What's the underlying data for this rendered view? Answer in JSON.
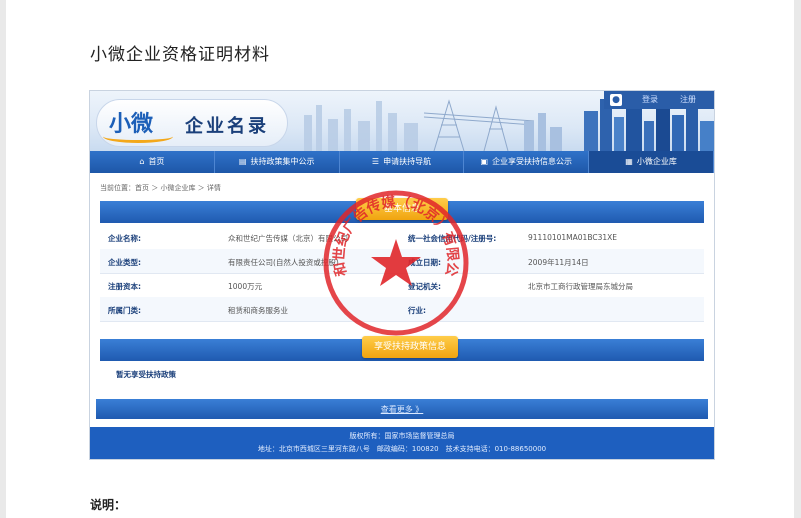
{
  "document": {
    "title": "小微企业资格证明材料",
    "note_label": "说明："
  },
  "site": {
    "logo_mark": "小微",
    "logo_text": "企业名录",
    "user_links": [
      "登录",
      "注册"
    ],
    "nav": [
      "首页",
      "扶持政策集中公示",
      "申请扶持导航",
      "企业享受扶持信息公示",
      "小微企业库"
    ],
    "active_nav": 4,
    "breadcrumb": "当前位置：首页 ＞ 小微企业库 ＞ 详情",
    "section_basic": "基本信息",
    "section_policy": "享受扶持政策信息",
    "rows": [
      {
        "l1": "企业名称:",
        "v1": "众和世纪广告传媒（北京）有限公司",
        "l2": "统一社会信用代码/注册号:",
        "v2": "91110101MA01BC31XE"
      },
      {
        "l1": "企业类型:",
        "v1": "有限责任公司(自然人投资或控股)",
        "l2": "成立日期:",
        "v2": "2009年11月14日"
      },
      {
        "l1": "注册资本:",
        "v1": "1000万元",
        "l2": "登记机关:",
        "v2": "北京市工商行政管理局东城分局"
      },
      {
        "l1": "所属门类:",
        "v1": "租赁和商务服务业",
        "l2": "行业:",
        "v2": ""
      }
    ],
    "policy_empty": "暂无享受扶持政策",
    "more_link": "查看更多 》",
    "footer_line1": "版权所有：国家市场监督管理总局",
    "footer_line2": "地址：北京市西城区三里河东路八号　邮政编码：100820　技术支持电话：010-88650000",
    "seal_text": "众和世纪广告传媒（北京）有限公司"
  },
  "colors": {
    "brand_blue": "#1e5fbf",
    "accent_orange": "#f0a40f",
    "seal_red": "#e0262a"
  }
}
